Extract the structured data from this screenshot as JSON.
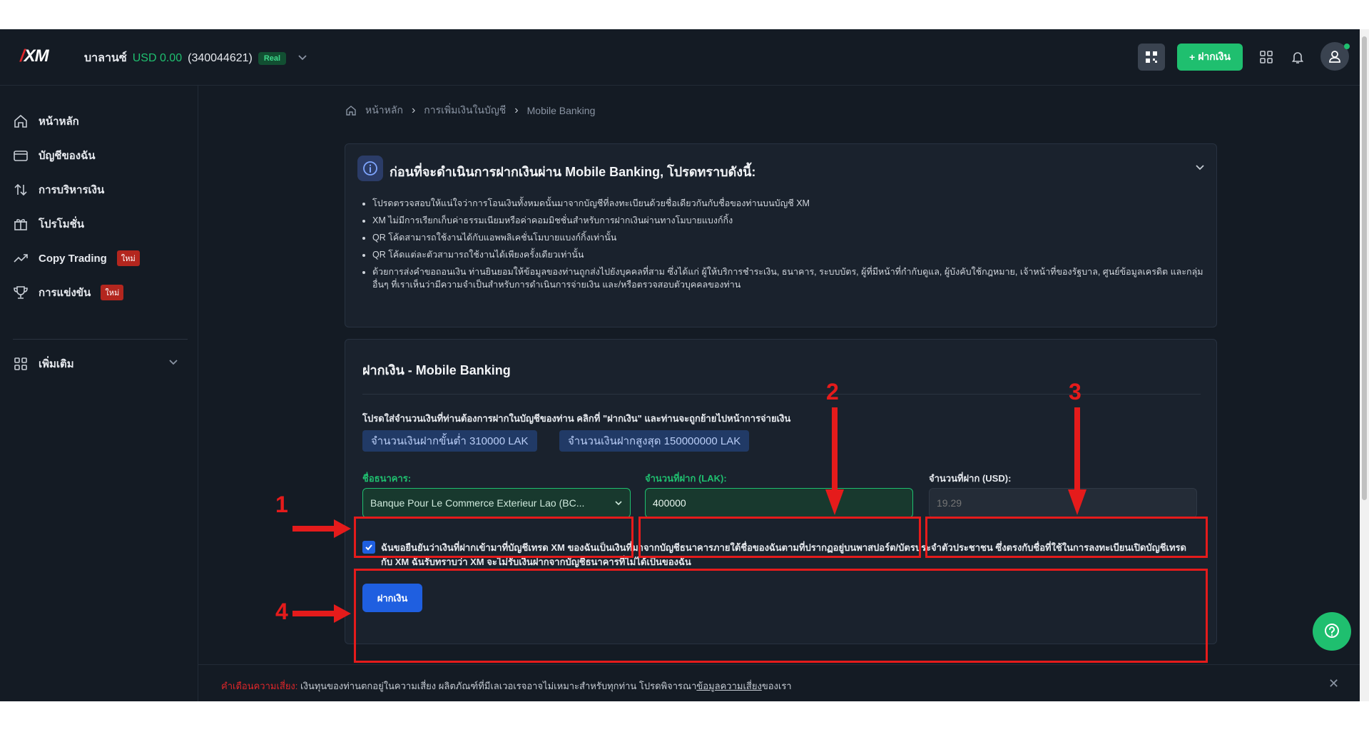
{
  "header": {
    "logo": "XM",
    "balance_label": "บาลานซ์",
    "balance_amount": "USD 0.00",
    "account_number": "(340044621)",
    "account_type": "Real",
    "deposit_button": "ฝากเงิน"
  },
  "sidebar": {
    "items": [
      {
        "label": "หน้าหลัก",
        "icon": "home-icon"
      },
      {
        "label": "บัญชีของฉัน",
        "icon": "wallet-icon"
      },
      {
        "label": "การบริหารเงิน",
        "icon": "transfer-icon"
      },
      {
        "label": "โปรโมชั่น",
        "icon": "gift-icon"
      },
      {
        "label": "Copy Trading",
        "icon": "trend-icon",
        "badge": "ใหม่"
      },
      {
        "label": "การแข่งขัน",
        "icon": "trophy-icon",
        "badge": "ใหม่"
      },
      {
        "label": "เพิ่มเติม",
        "icon": "grid-icon"
      }
    ]
  },
  "breadcrumb": [
    "หน้าหลัก",
    "การเพิ่มเงินในบัญชี",
    "Mobile Banking"
  ],
  "info": {
    "title": "ก่อนที่จะดำเนินการฝากเงินผ่าน Mobile Banking, โปรดทราบดังนี้:",
    "items": [
      "โปรดตรวจสอบให้แน่ใจว่าการโอนเงินทั้งหมดนั้นมาจากบัญชีที่ลงทะเบียนด้วยชื่อเดียวกันกับชื่อของท่านบนบัญชี XM",
      "XM ไม่มีการเรียกเก็บค่าธรรมเนียมหรือค่าคอมมิชชั่นสำหรับการฝากเงินผ่านทางโมบายแบงก์กิ้ง",
      "QR โค้ดสามารถใช้งานได้กับแอพพลิเคชั่นโมบายแบงก์กิ้งเท่านั้น",
      "QR โค้ดแต่ละตัวสามารถใช้งานได้เพียงครั้งเดียวเท่านั้น",
      "ด้วยการส่งคำขอถอนเงิน ท่านยินยอมให้ข้อมูลของท่านถูกส่งไปยังบุคคลที่สาม ซึ่งได้แก่ ผู้ให้บริการชำระเงิน, ธนาคาร, ระบบบัตร, ผู้ที่มีหน้าที่กำกับดูแล, ผู้บังคับใช้กฎหมาย, เจ้าหน้าที่ของรัฐบาล, ศูนย์ข้อมูลเครดิต และกลุ่มอื่นๆ ที่เราเห็นว่ามีความจำเป็นสำหรับการดำเนินการจ่ายเงิน และ/หรือตรวจสอบตัวบุคคลของท่าน"
    ]
  },
  "deposit": {
    "title": "ฝากเงิน - Mobile Banking",
    "description": "โปรดใส่จำนวนเงินที่ท่านต้องการฝากในบัญชีของท่าน คลิกที่ \"ฝากเงิน\" และท่านจะถูกย้ายไปหน้าการจ่ายเงิน",
    "min_label": "จำนวนเงินฝากขั้นต่ำ 310000 LAK",
    "max_label": "จำนวนเงินฝากสูงสุด 150000000 LAK",
    "bank_label": "ชื่อธนาคาร:",
    "bank_value": "Banque Pour Le Commerce Exterieur Lao (BC...",
    "amount_lak_label": "จำนวนที่ฝาก (LAK):",
    "amount_lak_value": "400000",
    "amount_usd_label": "จำนวนที่ฝาก (USD):",
    "amount_usd_value": "19.29",
    "confirm_text": "ฉันขอยืนยันว่าเงินที่ฝากเข้ามาที่บัญชีเทรด XM ของฉันเป็นเงินที่มาจากบัญชีธนาคารภายใต้ชื่อของฉันตามที่ปรากฏอยู่บนพาสปอร์ต/บัตรประจำตัวประชาชน ซึ่งตรงกับชื่อที่ใช้ในการลงทะเบียนเปิดบัญชีเทรดกับ XM ฉันรับทราบว่า XM จะไม่รับเงินฝากจากบัญชีธนาคารที่ไม่ได้เป็นของฉัน",
    "submit_label": "ฝากเงิน"
  },
  "annotations": [
    "1",
    "2",
    "3",
    "4"
  ],
  "footer": {
    "warning_label": "คำเตือนความเสี่ยง:",
    "text": "เงินทุนของท่านตกอยู่ในความเสี่ยง ผลิตภัณฑ์ที่มีเลเวอเรจอาจไม่เหมาะสำหรับทุกท่าน โปรดพิจารณา",
    "link": "ข้อมูลความเสี่ยง",
    "suffix": "ของเรา"
  },
  "colors": {
    "background": "#141b24",
    "panel": "#1a222d",
    "accent_green": "#1fbf6f",
    "primary_blue": "#1f5fe0",
    "annotation_red": "#e51b1b"
  }
}
